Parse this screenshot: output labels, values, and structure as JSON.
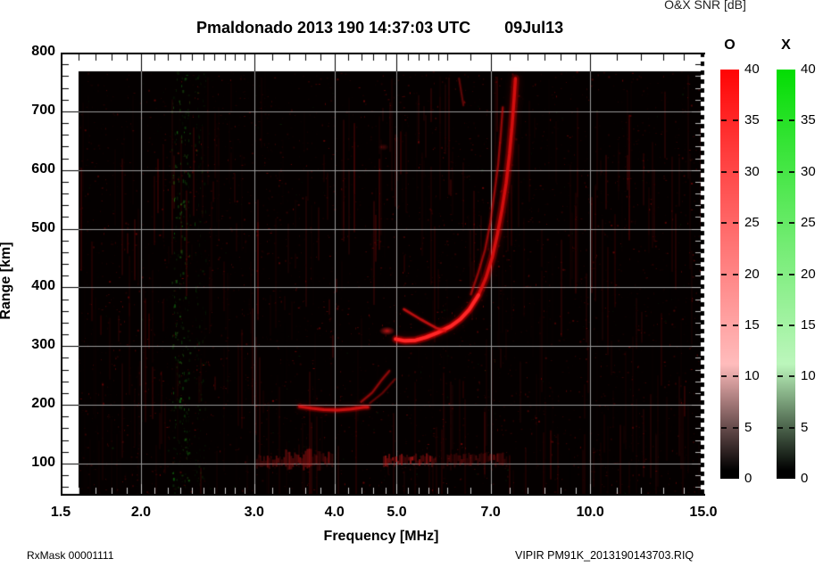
{
  "header": {
    "title_left": "Pmaldonado 2013 190 14:37:03 UTC",
    "title_right": "09Jul13",
    "colorbar_title": "O&X SNR [dB]"
  },
  "footer": {
    "rx_mask": "RxMask 00001111",
    "file_id": "VIPIR  PM91K_2013190143703.RIQ"
  },
  "chart_data": {
    "type": "heatmap",
    "title": "Pmaldonado 2013 190 14:37:03 UTC 09Jul13",
    "xlabel": "Frequency [MHz]",
    "ylabel": "Range [km]",
    "x_scale": "log",
    "xlim": [
      1.5,
      15
    ],
    "ylim": [
      45,
      800
    ],
    "x_ticks": [
      1.5,
      2,
      3,
      4,
      5,
      7,
      10,
      15
    ],
    "x_tick_labels": [
      "1.5",
      "2.0",
      "3.0",
      "4.0",
      "5.0",
      "7.0",
      "10.0",
      "15.0"
    ],
    "y_ticks": [
      800,
      700,
      600,
      500,
      400,
      300,
      200,
      100
    ],
    "y_tick_labels": [
      "800",
      "700",
      "600",
      "500",
      "400",
      "300",
      "200",
      "100"
    ],
    "grid": true,
    "grid_color": "#9a9a9a",
    "plot_bg": "#040000",
    "data_extent": {
      "f_min_mhz": 1.6,
      "f_max_mhz": 15,
      "km_min": 45,
      "km_max": 765
    },
    "colorbars": [
      {
        "label": "O",
        "min": 0,
        "max": 40,
        "ticks": [
          40,
          35,
          30,
          25,
          20,
          15,
          10,
          5,
          0
        ],
        "tick_labels": [
          "40",
          "35",
          "30",
          "25",
          "20",
          "15",
          "10",
          "5",
          "0"
        ],
        "color_top": "#ff0404",
        "color_bottom": "#000000"
      },
      {
        "label": "X",
        "min": 0,
        "max": 40,
        "ticks": [
          40,
          35,
          30,
          25,
          20,
          15,
          10,
          5,
          0
        ],
        "tick_labels": [
          "40",
          "35",
          "30",
          "25",
          "20",
          "15",
          "10",
          "5",
          "0"
        ],
        "color_top": "#03dd03",
        "color_bottom": "#000000"
      }
    ],
    "features": {
      "f2_layer_o_trace_f_km": [
        [
          4.98,
          312
        ],
        [
          5.15,
          309
        ],
        [
          5.35,
          310
        ],
        [
          5.55,
          315
        ],
        [
          5.79,
          323
        ],
        [
          6.07,
          334
        ],
        [
          6.28,
          346
        ],
        [
          6.49,
          363
        ],
        [
          6.7,
          387
        ],
        [
          6.88,
          416
        ],
        [
          7.04,
          451
        ],
        [
          7.17,
          490
        ],
        [
          7.29,
          533
        ],
        [
          7.4,
          578
        ],
        [
          7.49,
          628
        ],
        [
          7.56,
          677
        ],
        [
          7.61,
          719
        ],
        [
          7.65,
          756
        ]
      ],
      "f2_layer_second_trace_f_km": [
        [
          6.52,
          388
        ],
        [
          6.7,
          426
        ],
        [
          6.86,
          464
        ],
        [
          6.99,
          510
        ],
        [
          7.1,
          563
        ],
        [
          7.19,
          609
        ],
        [
          7.26,
          662
        ],
        [
          7.31,
          707
        ]
      ],
      "f1_cusp_trace_f_km": [
        [
          5.13,
          363
        ],
        [
          5.44,
          346
        ],
        [
          5.76,
          331
        ],
        [
          5.95,
          326
        ]
      ],
      "detached_echo_f_km": [
        4.83,
        326
      ],
      "faint_mid_echo_f_km": [
        4.77,
        639
      ],
      "upper_fade_streak_f_km": [
        [
          6.25,
          756
        ],
        [
          6.35,
          710
        ]
      ],
      "e_layer_trace_f_km": [
        [
          3.53,
          197
        ],
        [
          3.69,
          194
        ],
        [
          3.85,
          192
        ],
        [
          4.05,
          191
        ],
        [
          4.25,
          193
        ],
        [
          4.45,
          196
        ],
        [
          4.51,
          196
        ]
      ],
      "e_layer_rise_f_km": [
        [
          4.4,
          205
        ],
        [
          4.58,
          221
        ],
        [
          4.75,
          244
        ],
        [
          4.87,
          258
        ]
      ],
      "e_layer_rise_echo_f_km": [
        [
          4.54,
          203
        ],
        [
          4.75,
          220
        ],
        [
          4.97,
          244
        ]
      ],
      "sporadic_e_patches": [
        {
          "f1": 3.02,
          "f2": 3.31,
          "km": 104,
          "h_km": 16,
          "intensity": 0.45
        },
        {
          "f1": 3.33,
          "f2": 3.96,
          "km": 106,
          "h_km": 26,
          "intensity": 0.6
        },
        {
          "f1": 4.76,
          "f2": 5.74,
          "km": 105,
          "h_km": 16,
          "intensity": 0.75
        },
        {
          "f1": 5.98,
          "f2": 7.4,
          "km": 107,
          "h_km": 18,
          "intensity": 0.5
        }
      ],
      "green_rfi_bands": [
        {
          "f1": 2.23,
          "f2": 2.38,
          "intensity": 0.55
        },
        {
          "f1": 2.42,
          "f2": 2.52,
          "intensity": 0.25
        }
      ]
    }
  }
}
